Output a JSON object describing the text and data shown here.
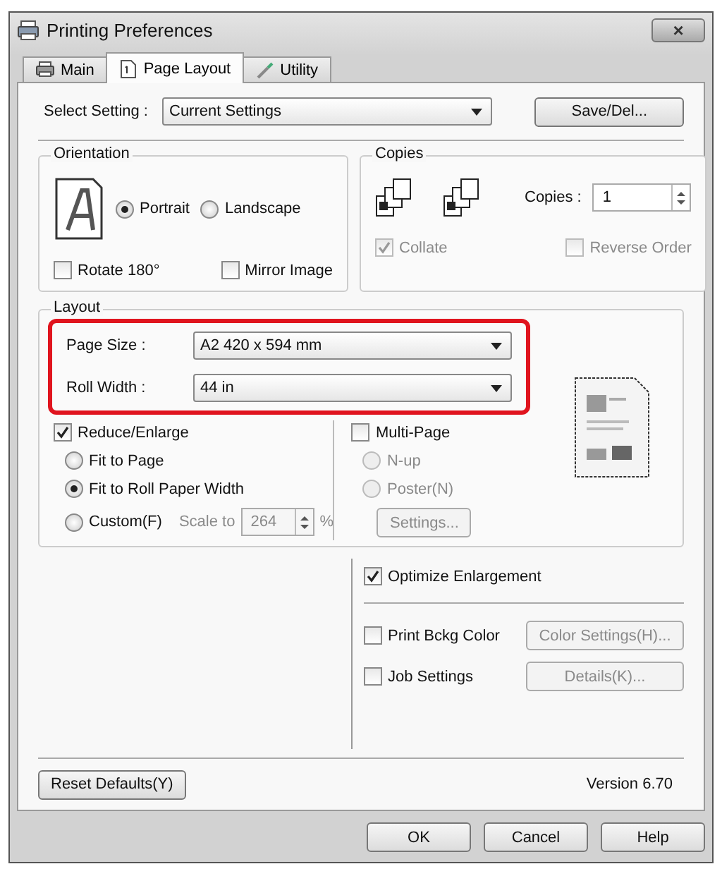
{
  "window": {
    "title": "Printing Preferences",
    "close": "×"
  },
  "tabs": [
    {
      "label": "Main",
      "selected": false
    },
    {
      "label": "Page Layout",
      "selected": true
    },
    {
      "label": "Utility",
      "selected": false
    }
  ],
  "select_setting": {
    "label": "Select Setting :",
    "value": "Current Settings",
    "button": "Save/Del..."
  },
  "orientation": {
    "title": "Orientation",
    "options": [
      {
        "label": "Portrait",
        "selected": true
      },
      {
        "label": "Landscape",
        "selected": false
      }
    ],
    "checkboxes": [
      {
        "label": "Rotate 180°",
        "checked": false
      },
      {
        "label": "Mirror Image",
        "checked": false
      }
    ]
  },
  "copies": {
    "title": "Copies",
    "copies_label": "Copies :",
    "copies_value": "1",
    "checkboxes": [
      {
        "label": "Collate",
        "checked": true,
        "disabled": true
      },
      {
        "label": "Reverse Order",
        "checked": false,
        "disabled": true
      }
    ]
  },
  "layout": {
    "title": "Layout",
    "highlighted": true,
    "fields": [
      {
        "label": "Page Size :",
        "value": "A2 420 x 594 mm"
      },
      {
        "label": "Roll Width :",
        "value": "44 in"
      }
    ],
    "reduce_enlarge": {
      "label": "Reduce/Enlarge",
      "checked": true,
      "options": [
        {
          "label": "Fit to Page",
          "selected": false
        },
        {
          "label": "Fit to Roll Paper Width",
          "selected": true
        },
        {
          "label": "Custom(F)",
          "selected": false
        }
      ],
      "scale_label": "Scale to",
      "scale_value": "264",
      "scale_unit": "%",
      "scale_disabled": true
    },
    "multi_page": {
      "label": "Multi-Page",
      "checked": false,
      "options": [
        {
          "label": "N-up",
          "selected": false,
          "disabled": true
        },
        {
          "label": "Poster(N)",
          "selected": false,
          "disabled": true
        }
      ],
      "settings_button": {
        "label": "Settings...",
        "disabled": true
      }
    }
  },
  "options": [
    {
      "kind": "check",
      "label": "Optimize Enlargement",
      "checked": true
    },
    {
      "kind": "rule"
    },
    {
      "kind": "check_button",
      "label": "Print Bckg Color",
      "checked": false,
      "button": "Color Settings(H)...",
      "button_disabled": true
    },
    {
      "kind": "check_button",
      "label": "Job Settings",
      "checked": false,
      "button": "Details(K)...",
      "button_disabled": true
    }
  ],
  "reset_button": "Reset Defaults(Y)",
  "version": "Version 6.70",
  "buttons": [
    "OK",
    "Cancel",
    "Help"
  ]
}
